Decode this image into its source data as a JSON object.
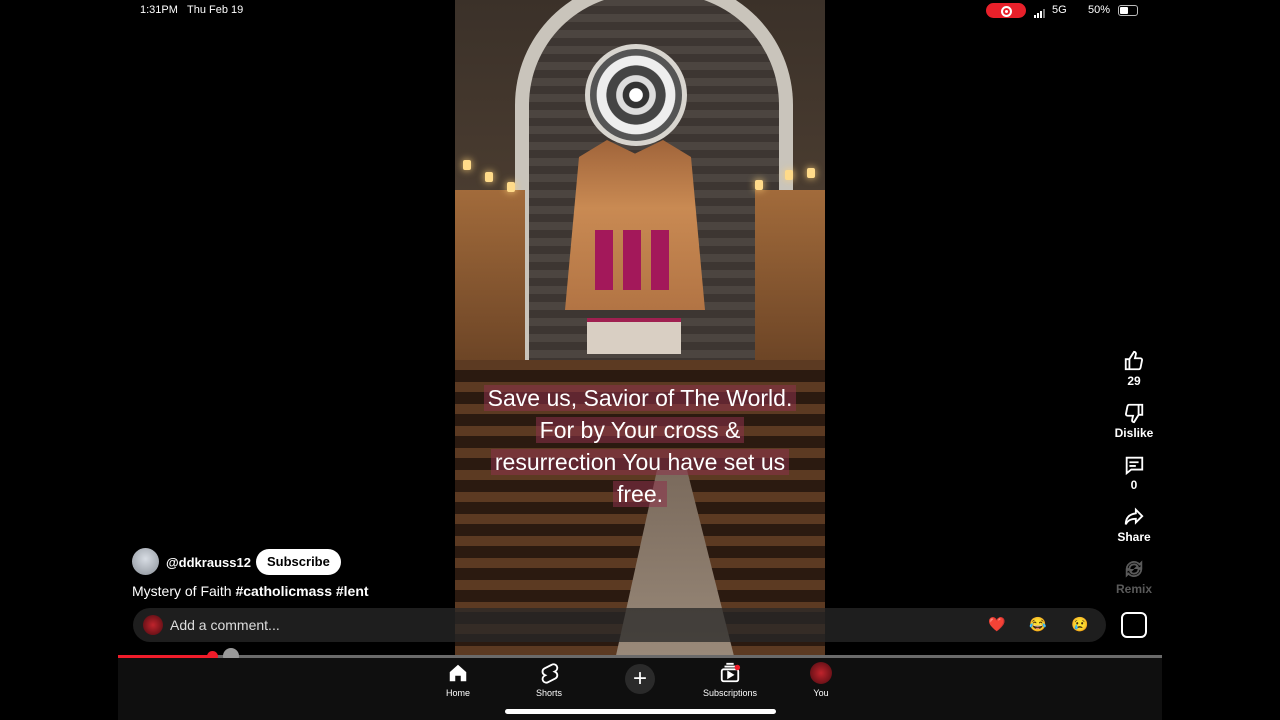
{
  "status_bar": {
    "time": "1:31PM",
    "date": "Thu Feb 19",
    "network": "5G",
    "battery": "50%"
  },
  "video": {
    "caption_lines": [
      "Save us, Savior of The World.",
      "For by Your cross &",
      "resurrection You have set us",
      "free."
    ]
  },
  "actions": {
    "like_count": "29",
    "dislike_label": "Dislike",
    "comment_count": "0",
    "share_label": "Share",
    "remix_label": "Remix"
  },
  "channel": {
    "handle": "@ddkrauss12",
    "subscribe_label": "Subscribe"
  },
  "description": {
    "text": "Mystery of Faith",
    "tags": "#catholicmass #lent"
  },
  "comment_box": {
    "placeholder": "Add a comment...",
    "emojis": [
      "❤️",
      "😂",
      "😢"
    ]
  },
  "progress": {
    "played_fraction": 0.09,
    "buffered_fraction": 0.108
  },
  "nav": {
    "items": [
      {
        "label": "Home",
        "icon": "home-icon"
      },
      {
        "label": "Shorts",
        "icon": "shorts-icon"
      },
      {
        "label": "",
        "icon": "plus-icon"
      },
      {
        "label": "Subscriptions",
        "icon": "subscriptions-icon"
      },
      {
        "label": "You",
        "icon": "avatar"
      }
    ]
  },
  "colors": {
    "accent": "#f01c2a",
    "recording": "#e8202a"
  }
}
